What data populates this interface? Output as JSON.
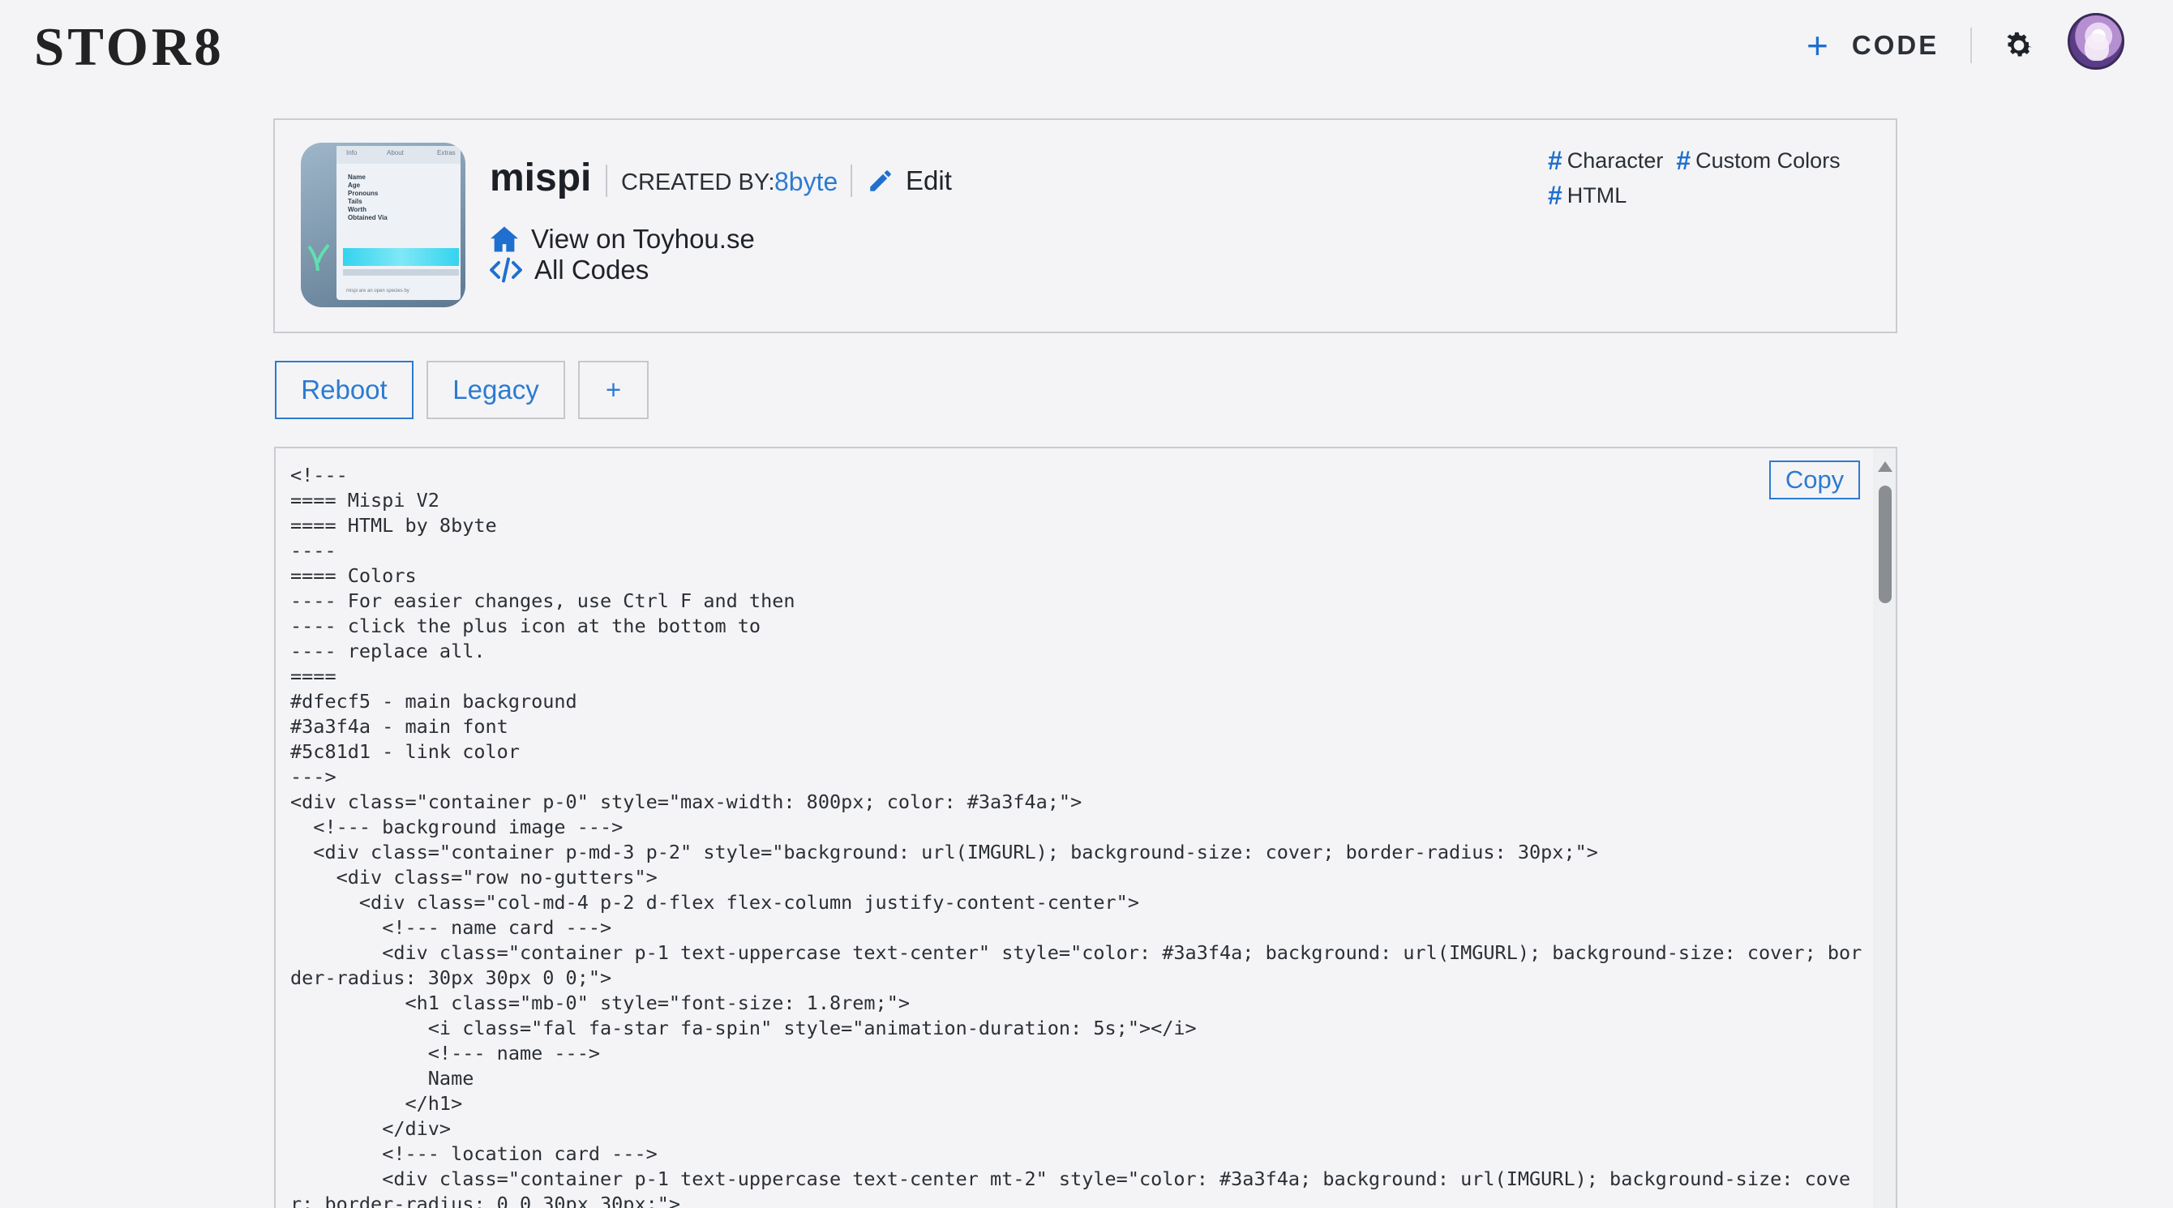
{
  "header": {
    "logo": "STOR8",
    "code_label": "CODE",
    "plus_glyph": "+",
    "settings_icon": "gear-icon",
    "avatar_icon": "avatar"
  },
  "profile": {
    "name": "mispi",
    "created_by_label": "CREATED BY:",
    "creator": "8byte",
    "edit_label": "Edit",
    "view_link": "View on Toyhou.se",
    "all_codes": "All Codes",
    "tags": [
      "Character",
      "Custom Colors",
      "HTML"
    ],
    "tag_hash": "#"
  },
  "thumbnail": {
    "tabs": [
      "Info",
      "About",
      "Extras"
    ],
    "fields": [
      "Name",
      "Age",
      "Pronouns",
      "Tails",
      "Worth",
      "Obtained Via"
    ],
    "footer": "mispi are an open species by"
  },
  "versions": {
    "reboot": "Reboot",
    "legacy": "Legacy",
    "add": "+"
  },
  "code_panel": {
    "copy_label": "Copy",
    "code": "<!---\n==== Mispi V2\n==== HTML by 8byte\n----\n==== Colors\n---- For easier changes, use Ctrl F and then\n---- click the plus icon at the bottom to\n---- replace all.\n====\n#dfecf5 - main background\n#3a3f4a - main font\n#5c81d1 - link color\n--->\n<div class=\"container p-0\" style=\"max-width: 800px; color: #3a3f4a;\">\n  <!--- background image --->\n  <div class=\"container p-md-3 p-2\" style=\"background: url(IMGURL); background-size: cover; border-radius: 30px;\">\n    <div class=\"row no-gutters\">\n      <div class=\"col-md-4 p-2 d-flex flex-column justify-content-center\">\n        <!--- name card --->\n        <div class=\"container p-1 text-uppercase text-center\" style=\"color: #3a3f4a; background: url(IMGURL); background-size: cover; border-radius: 30px 30px 0 0;\">\n          <h1 class=\"mb-0\" style=\"font-size: 1.8rem;\">\n            <i class=\"fal fa-star fa-spin\" style=\"animation-duration: 5s;\"></i>\n            <!--- name --->\n            Name\n          </h1>\n        </div>\n        <!--- location card --->\n        <div class=\"container p-1 text-uppercase text-center mt-2\" style=\"color: #3a3f4a; background: url(IMGURL); background-size: cover; border-radius: 0 0 30px 30px;\">"
  },
  "colors": {
    "accent": "#2c7bd1",
    "background": "#f4f4f6",
    "border": "#c9ccd1"
  }
}
